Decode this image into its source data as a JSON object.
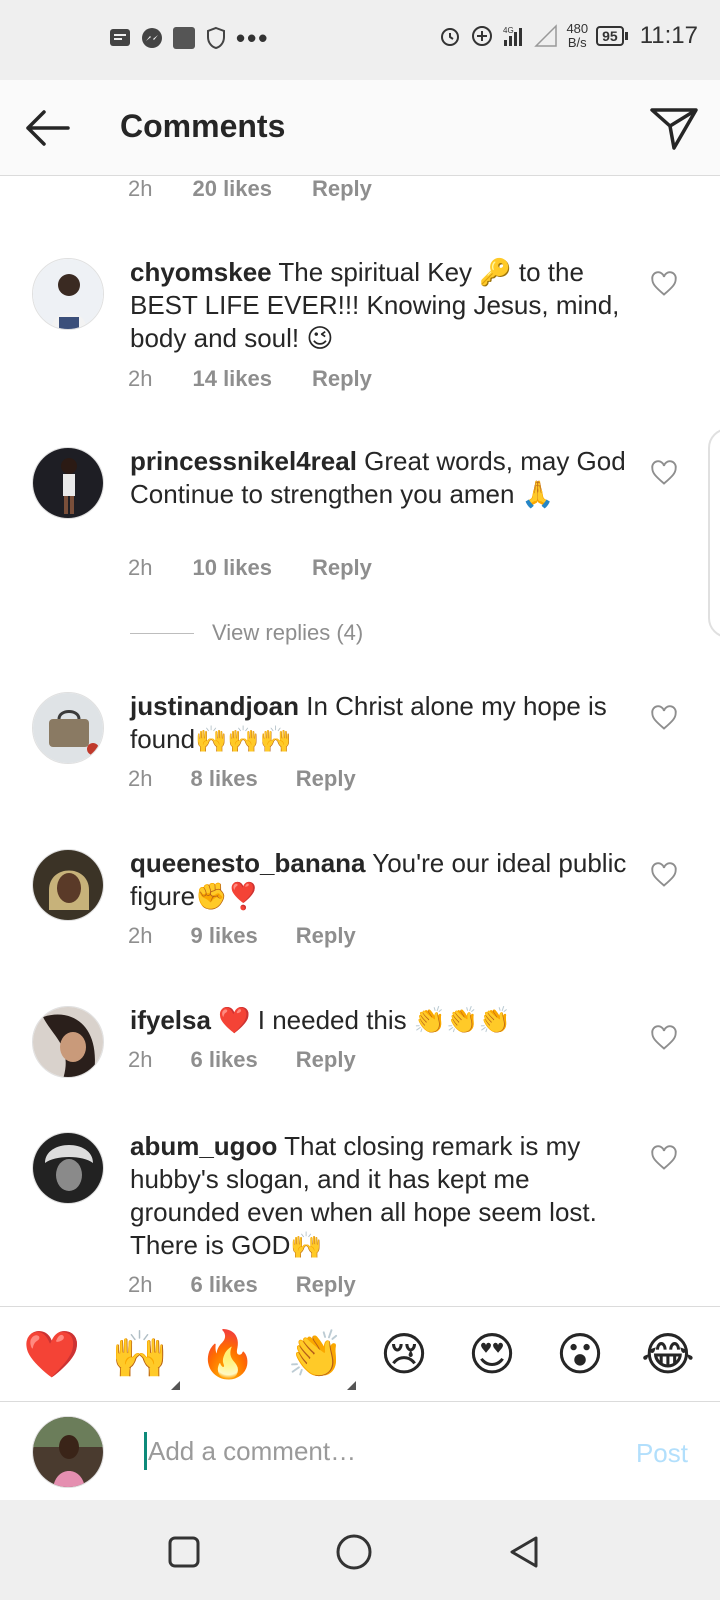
{
  "status_bar": {
    "speed_value": "480",
    "speed_unit": "B/s",
    "network_label": "4G",
    "battery": "95",
    "time": "11:17"
  },
  "header": {
    "title": "Comments"
  },
  "partial_top_meta": {
    "time": "2h",
    "likes": "20 likes",
    "reply": "Reply"
  },
  "comments": [
    {
      "username": "chyomskee",
      "text": " The spiritual Key 🔑 to the BEST LIFE EVER!!! Knowing Jesus, mind, body and soul! 😉",
      "time": "2h",
      "likes": "14 likes",
      "reply": "Reply"
    },
    {
      "username": "princessnikel4real",
      "text": " Great words, may God Continue to strengthen you amen 🙏",
      "time": "2h",
      "likes": "10 likes",
      "reply": "Reply"
    },
    {
      "username": "justinandjoan",
      "text": " In Christ alone my hope is found🙌🙌🙌",
      "time": "2h",
      "likes": "8 likes",
      "reply": "Reply"
    },
    {
      "username": "queenesto_banana",
      "text": " You're our ideal public figure✊❣️",
      "time": "2h",
      "likes": "9 likes",
      "reply": "Reply"
    },
    {
      "username": "ifyelsa",
      "text": " ❤️ I needed this 👏👏👏",
      "time": "2h",
      "likes": "6 likes",
      "reply": "Reply"
    },
    {
      "username": "abum_ugoo",
      "text": " That closing remark is my hubby's slogan, and it has kept me grounded even when all hope seem lost. There is GOD🙌",
      "time": "2h",
      "likes": "6 likes",
      "reply": "Reply"
    }
  ],
  "view_replies": "View replies (4)",
  "emoji_bar": [
    "❤️",
    "🙌",
    "🔥",
    "👏",
    "😢",
    "😍",
    "😮",
    "😂"
  ],
  "composer": {
    "placeholder": "Add a comment…",
    "post_label": "Post"
  },
  "colors": {
    "text": "#262626",
    "meta": "#8e8e8e",
    "post_disabled": "#b2dffc",
    "caret": "#0d8a7a"
  }
}
